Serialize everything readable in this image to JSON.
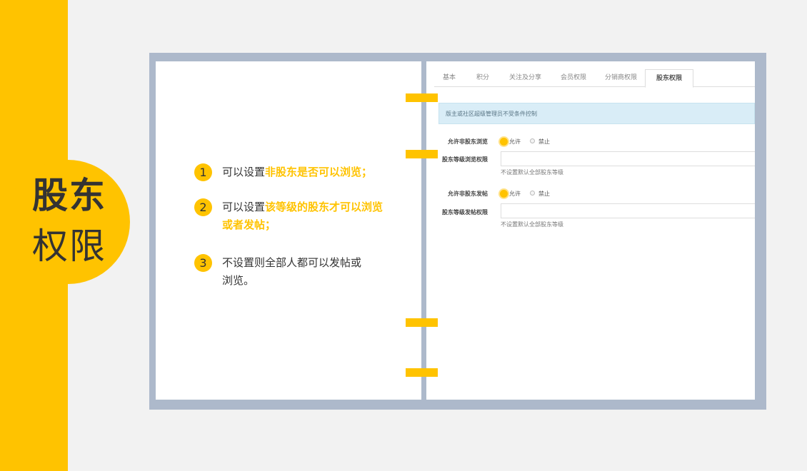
{
  "slide": {
    "title_line1": "股东",
    "title_line2": "权限",
    "steps": [
      {
        "num": "1",
        "text_before": "可以设置",
        "highlight": "非股东是否可以浏览；",
        "text_after": ""
      },
      {
        "num": "2",
        "text_before": "可以设置",
        "highlight": "该等级的股东才可以浏览或者发帖；",
        "text_after": ""
      },
      {
        "num": "3",
        "text_before": "不设置则全部人都可以发帖或浏览。",
        "highlight": "",
        "text_after": ""
      }
    ]
  },
  "tabs": [
    {
      "label": "基本",
      "active": false
    },
    {
      "label": "积分",
      "active": false
    },
    {
      "label": "关注及分享",
      "active": false
    },
    {
      "label": "会员权限",
      "active": false
    },
    {
      "label": "分销商权限",
      "active": false
    },
    {
      "label": "股东权限",
      "active": true
    }
  ],
  "notice": "版主或社区超级管理员不受条件控制",
  "form": {
    "browse_label": "允许非股东浏览",
    "browse_allow": "允许",
    "browse_forbid": "禁止",
    "browse_level_label": "股东等级浏览权限",
    "browse_level_hint": "不设置默认全部股东等级",
    "post_label": "允许非股东发帖",
    "post_allow": "允许",
    "post_forbid": "禁止",
    "post_level_label": "股东等级发帖权限",
    "post_level_hint": "不设置默认全部股东等级"
  },
  "colors": {
    "accent": "#ffc300",
    "frame": "#adb9cb",
    "notice_bg": "#d9edf7"
  }
}
